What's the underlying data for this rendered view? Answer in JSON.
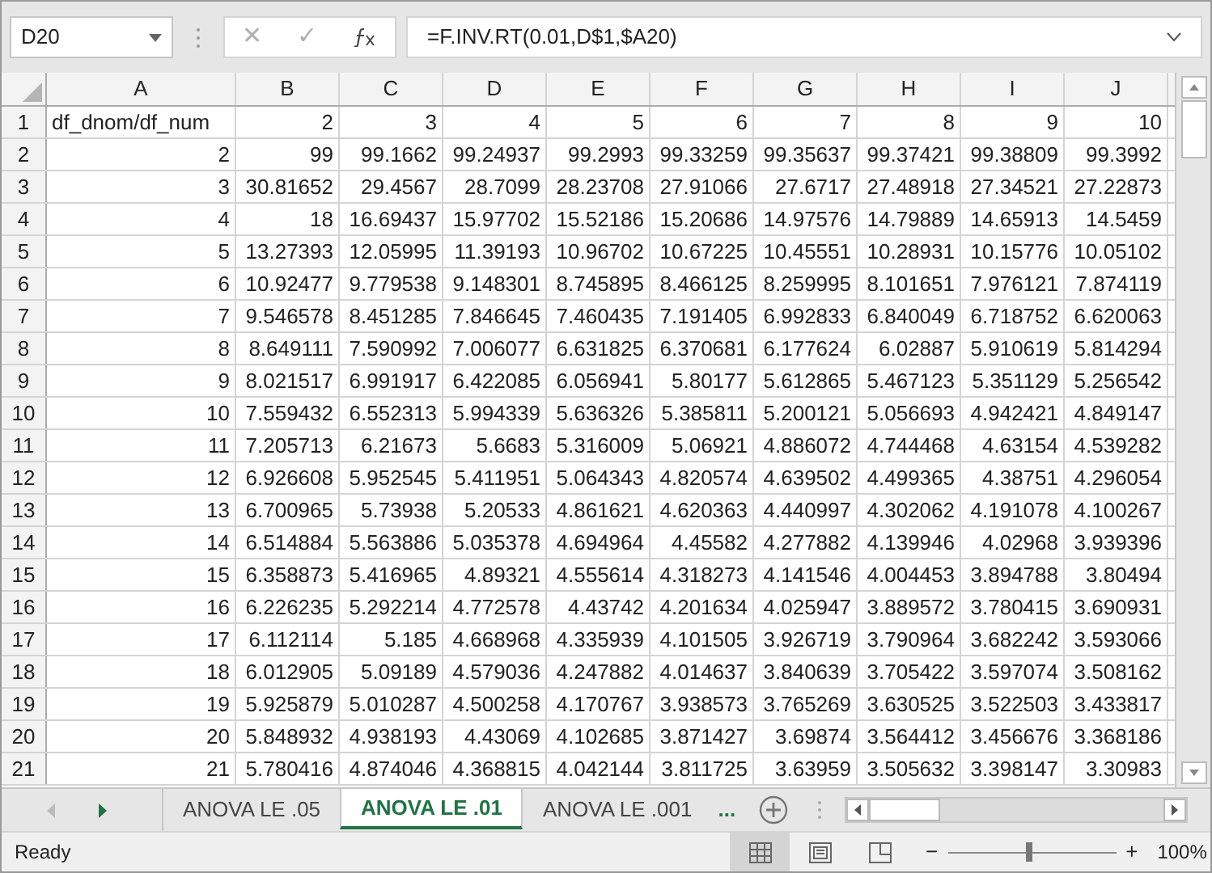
{
  "name_box": "D20",
  "formula_buttons": [
    "✕",
    "✓"
  ],
  "formula": "=F.INV.RT(0.01,D$1,$A20)",
  "columns": [
    "A",
    "B",
    "C",
    "D",
    "E",
    "F",
    "G",
    "H",
    "I",
    "J"
  ],
  "rows": [
    {
      "number": "1",
      "cells": [
        "df_dnom/df_num",
        "2",
        "3",
        "4",
        "5",
        "6",
        "7",
        "8",
        "9",
        "10"
      ]
    },
    {
      "number": "2",
      "cells": [
        "2",
        "99",
        "99.1662",
        "99.24937",
        "99.2993",
        "99.33259",
        "99.35637",
        "99.37421",
        "99.38809",
        "99.3992"
      ]
    },
    {
      "number": "3",
      "cells": [
        "3",
        "30.81652",
        "29.4567",
        "28.7099",
        "28.23708",
        "27.91066",
        "27.6717",
        "27.48918",
        "27.34521",
        "27.22873"
      ]
    },
    {
      "number": "4",
      "cells": [
        "4",
        "18",
        "16.69437",
        "15.97702",
        "15.52186",
        "15.20686",
        "14.97576",
        "14.79889",
        "14.65913",
        "14.5459"
      ]
    },
    {
      "number": "5",
      "cells": [
        "5",
        "13.27393",
        "12.05995",
        "11.39193",
        "10.96702",
        "10.67225",
        "10.45551",
        "10.28931",
        "10.15776",
        "10.05102"
      ]
    },
    {
      "number": "6",
      "cells": [
        "6",
        "10.92477",
        "9.779538",
        "9.148301",
        "8.745895",
        "8.466125",
        "8.259995",
        "8.101651",
        "7.976121",
        "7.874119"
      ]
    },
    {
      "number": "7",
      "cells": [
        "7",
        "9.546578",
        "8.451285",
        "7.846645",
        "7.460435",
        "7.191405",
        "6.992833",
        "6.840049",
        "6.718752",
        "6.620063"
      ]
    },
    {
      "number": "8",
      "cells": [
        "8",
        "8.649111",
        "7.590992",
        "7.006077",
        "6.631825",
        "6.370681",
        "6.177624",
        "6.02887",
        "5.910619",
        "5.814294"
      ]
    },
    {
      "number": "9",
      "cells": [
        "9",
        "8.021517",
        "6.991917",
        "6.422085",
        "6.056941",
        "5.80177",
        "5.612865",
        "5.467123",
        "5.351129",
        "5.256542"
      ]
    },
    {
      "number": "10",
      "cells": [
        "10",
        "7.559432",
        "6.552313",
        "5.994339",
        "5.636326",
        "5.385811",
        "5.200121",
        "5.056693",
        "4.942421",
        "4.849147"
      ]
    },
    {
      "number": "11",
      "cells": [
        "11",
        "7.205713",
        "6.21673",
        "5.6683",
        "5.316009",
        "5.06921",
        "4.886072",
        "4.744468",
        "4.63154",
        "4.539282"
      ]
    },
    {
      "number": "12",
      "cells": [
        "12",
        "6.926608",
        "5.952545",
        "5.411951",
        "5.064343",
        "4.820574",
        "4.639502",
        "4.499365",
        "4.38751",
        "4.296054"
      ]
    },
    {
      "number": "13",
      "cells": [
        "13",
        "6.700965",
        "5.73938",
        "5.20533",
        "4.861621",
        "4.620363",
        "4.440997",
        "4.302062",
        "4.191078",
        "4.100267"
      ]
    },
    {
      "number": "14",
      "cells": [
        "14",
        "6.514884",
        "5.563886",
        "5.035378",
        "4.694964",
        "4.45582",
        "4.277882",
        "4.139946",
        "4.02968",
        "3.939396"
      ]
    },
    {
      "number": "15",
      "cells": [
        "15",
        "6.358873",
        "5.416965",
        "4.89321",
        "4.555614",
        "4.318273",
        "4.141546",
        "4.004453",
        "3.894788",
        "3.80494"
      ]
    },
    {
      "number": "16",
      "cells": [
        "16",
        "6.226235",
        "5.292214",
        "4.772578",
        "4.43742",
        "4.201634",
        "4.025947",
        "3.889572",
        "3.780415",
        "3.690931"
      ]
    },
    {
      "number": "17",
      "cells": [
        "17",
        "6.112114",
        "5.185",
        "4.668968",
        "4.335939",
        "4.101505",
        "3.926719",
        "3.790964",
        "3.682242",
        "3.593066"
      ]
    },
    {
      "number": "18",
      "cells": [
        "18",
        "6.012905",
        "5.09189",
        "4.579036",
        "4.247882",
        "4.014637",
        "3.840639",
        "3.705422",
        "3.597074",
        "3.508162"
      ]
    },
    {
      "number": "19",
      "cells": [
        "19",
        "5.925879",
        "5.010287",
        "4.500258",
        "4.170767",
        "3.938573",
        "3.765269",
        "3.630525",
        "3.522503",
        "3.433817"
      ]
    },
    {
      "number": "20",
      "cells": [
        "20",
        "5.848932",
        "4.938193",
        "4.43069",
        "4.102685",
        "3.871427",
        "3.69874",
        "3.564412",
        "3.456676",
        "3.368186"
      ]
    },
    {
      "number": "21",
      "cells": [
        "21",
        "5.780416",
        "4.874046",
        "4.368815",
        "4.042144",
        "3.811725",
        "3.63959",
        "3.505632",
        "3.398147",
        "3.30983"
      ]
    }
  ],
  "sheet_tabs": [
    {
      "label": "ANOVA LE .05",
      "selected": false
    },
    {
      "label": "ANOVA LE .01",
      "selected": true
    },
    {
      "label": "ANOVA LE .001",
      "selected": false
    }
  ],
  "more_tabs": "...",
  "status": "Ready",
  "views": [
    {
      "kind": "normal",
      "selected": true
    },
    {
      "kind": "page_layout",
      "selected": false
    },
    {
      "kind": "page_break",
      "selected": false
    }
  ],
  "zoom": {
    "minus": "−",
    "plus": "+",
    "level": 0.5,
    "reading": "100%"
  }
}
